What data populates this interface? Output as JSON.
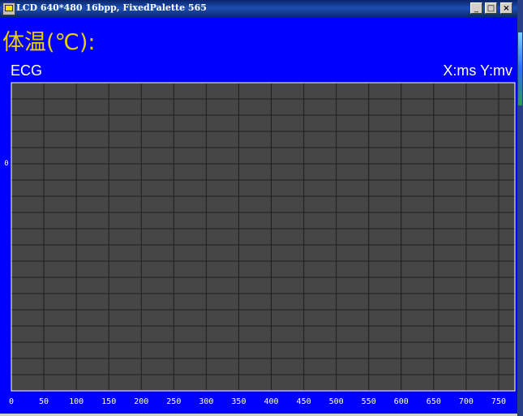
{
  "window": {
    "title": "LCD 640*480 16bpp, FixedPalette 565",
    "buttons": {
      "minimize": "_",
      "maximize": "□",
      "close": "×"
    }
  },
  "header": {
    "title": "体温(℃):"
  },
  "chart_data": {
    "type": "line",
    "title": "ECG",
    "axis_units": "X:ms  Y:mv",
    "xlim": [
      0,
      775
    ],
    "x_ticks": [
      0,
      50,
      100,
      150,
      200,
      250,
      300,
      350,
      400,
      450,
      500,
      550,
      600,
      650,
      700,
      750
    ],
    "y_ticks": [
      0
    ],
    "grid": true,
    "series": [],
    "colors": {
      "background": "#0000ff",
      "plot": "#464646",
      "grid": "#1e1e1e",
      "frame": "#ffffff",
      "title": "#e8d000"
    }
  }
}
